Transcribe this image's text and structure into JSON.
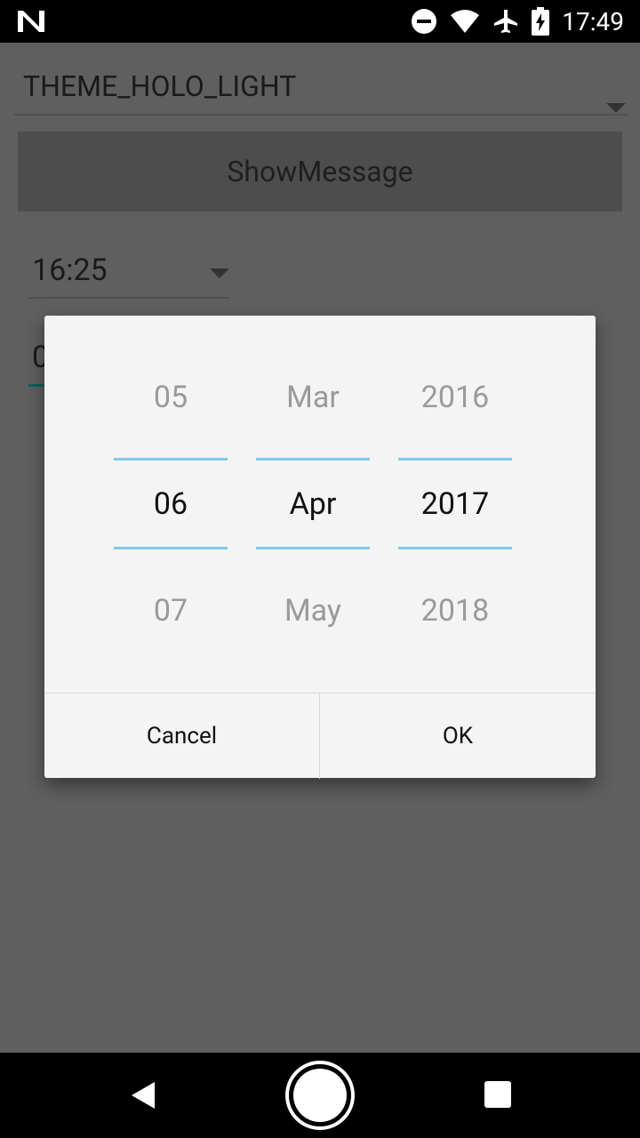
{
  "status_bar": {
    "time": "17:49",
    "icons": [
      "n-logo-icon",
      "do-not-disturb-icon",
      "wifi-icon",
      "airplane-icon",
      "battery-icon"
    ]
  },
  "app": {
    "theme_spinner": {
      "value": "THEME_HOLO_LIGHT"
    },
    "show_message_button": {
      "label": "ShowMessage"
    },
    "time_spinner": {
      "value": "16:25"
    },
    "date_field_partial": "0"
  },
  "date_picker_dialog": {
    "day": {
      "prev": "05",
      "current": "06",
      "next": "07"
    },
    "month": {
      "prev": "Mar",
      "current": "Apr",
      "next": "May"
    },
    "year": {
      "prev": "2016",
      "current": "2017",
      "next": "2018"
    },
    "cancel_label": "Cancel",
    "ok_label": "OK",
    "accent_color": "#81c8e8"
  },
  "nav_bar": {
    "icons": [
      "back-icon",
      "home-icon",
      "recents-icon"
    ]
  }
}
